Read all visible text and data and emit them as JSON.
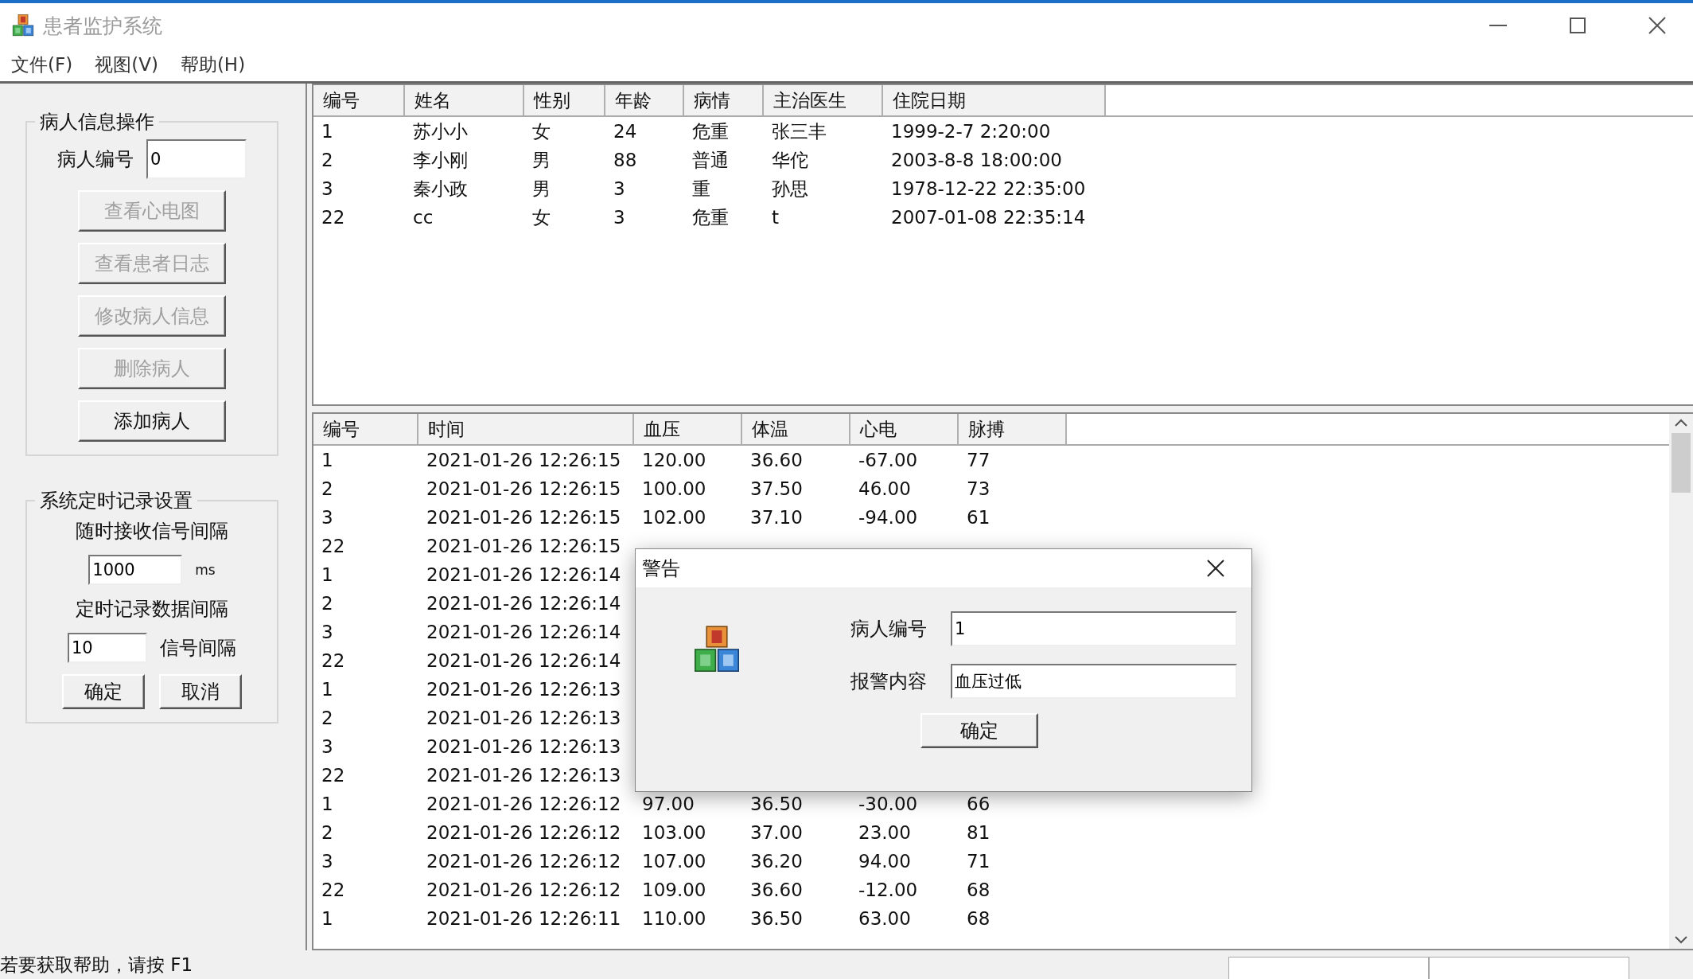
{
  "window": {
    "title": "患者监护系统"
  },
  "menu": [
    "文件(F)",
    "视图(V)",
    "帮助(H)"
  ],
  "patient_ops": {
    "title": "病人信息操作",
    "id_label": "病人编号",
    "id_value": "0",
    "buttons": [
      {
        "label": "查看心电图",
        "disabled": true
      },
      {
        "label": "查看患者日志",
        "disabled": true
      },
      {
        "label": "修改病人信息",
        "disabled": true
      },
      {
        "label": "删除病人",
        "disabled": true
      },
      {
        "label": "添加病人",
        "disabled": false
      }
    ]
  },
  "timer_settings": {
    "title": "系统定时记录设置",
    "receive_label": "随时接收信号间隔",
    "receive_value": "1000",
    "receive_unit": "ms",
    "record_label": "定时记录数据间隔",
    "record_value": "10",
    "record_unit": "信号间隔",
    "buttons": [
      "确定",
      "取消"
    ]
  },
  "patients_table": {
    "columns": [
      "编号",
      "姓名",
      "性别",
      "年龄",
      "病情",
      "主治医生",
      "住院日期"
    ],
    "rows": [
      [
        "1",
        "苏小小",
        "女",
        "24",
        "危重",
        "张三丰",
        "1999-2-7 2:20:00"
      ],
      [
        "2",
        "李小刚",
        "男",
        "88",
        "普通",
        "华佗",
        "2003-8-8 18:00:00"
      ],
      [
        "3",
        "秦小政",
        "男",
        "3",
        "重",
        "孙思",
        "1978-12-22 22:35:00"
      ],
      [
        "22",
        "cc",
        "女",
        "3",
        "危重",
        "t",
        "2007-01-08 22:35:14"
      ]
    ]
  },
  "records_table": {
    "columns": [
      "编号",
      "时间",
      "血压",
      "体温",
      "心电",
      "脉搏"
    ],
    "rows": [
      [
        "1",
        "2021-01-26 12:26:15",
        "120.00",
        "36.60",
        "-67.00",
        "77"
      ],
      [
        "2",
        "2021-01-26 12:26:15",
        "100.00",
        "37.50",
        "46.00",
        "73"
      ],
      [
        "3",
        "2021-01-26 12:26:15",
        "102.00",
        "37.10",
        "-94.00",
        "61"
      ],
      [
        "22",
        "2021-01-26 12:26:15",
        null,
        null,
        null,
        null
      ],
      [
        "1",
        "2021-01-26 12:26:14",
        null,
        null,
        null,
        null
      ],
      [
        "2",
        "2021-01-26 12:26:14",
        null,
        null,
        null,
        null
      ],
      [
        "3",
        "2021-01-26 12:26:14",
        null,
        null,
        null,
        null
      ],
      [
        "22",
        "2021-01-26 12:26:14",
        null,
        null,
        null,
        null
      ],
      [
        "1",
        "2021-01-26 12:26:13",
        null,
        null,
        null,
        null
      ],
      [
        "2",
        "2021-01-26 12:26:13",
        null,
        null,
        null,
        null
      ],
      [
        "3",
        "2021-01-26 12:26:13",
        null,
        null,
        null,
        null
      ],
      [
        "22",
        "2021-01-26 12:26:13",
        null,
        null,
        null,
        null
      ],
      [
        "1",
        "2021-01-26 12:26:12",
        "97.00",
        "36.50",
        "-30.00",
        "66"
      ],
      [
        "2",
        "2021-01-26 12:26:12",
        "103.00",
        "37.00",
        "23.00",
        "81"
      ],
      [
        "3",
        "2021-01-26 12:26:12",
        "107.00",
        "36.20",
        "94.00",
        "71"
      ],
      [
        "22",
        "2021-01-26 12:26:12",
        "109.00",
        "36.60",
        "-12.00",
        "68"
      ],
      [
        "1",
        "2021-01-26 12:26:11",
        "110.00",
        "36.50",
        "63.00",
        "68"
      ]
    ]
  },
  "alert_dialog": {
    "title": "警告",
    "fields": [
      {
        "label": "病人编号",
        "value": "1"
      },
      {
        "label": "报警内容",
        "value": "血压过低"
      }
    ],
    "button": "确定"
  },
  "status_bar": {
    "text": "若要获取帮助，请按 F1"
  }
}
